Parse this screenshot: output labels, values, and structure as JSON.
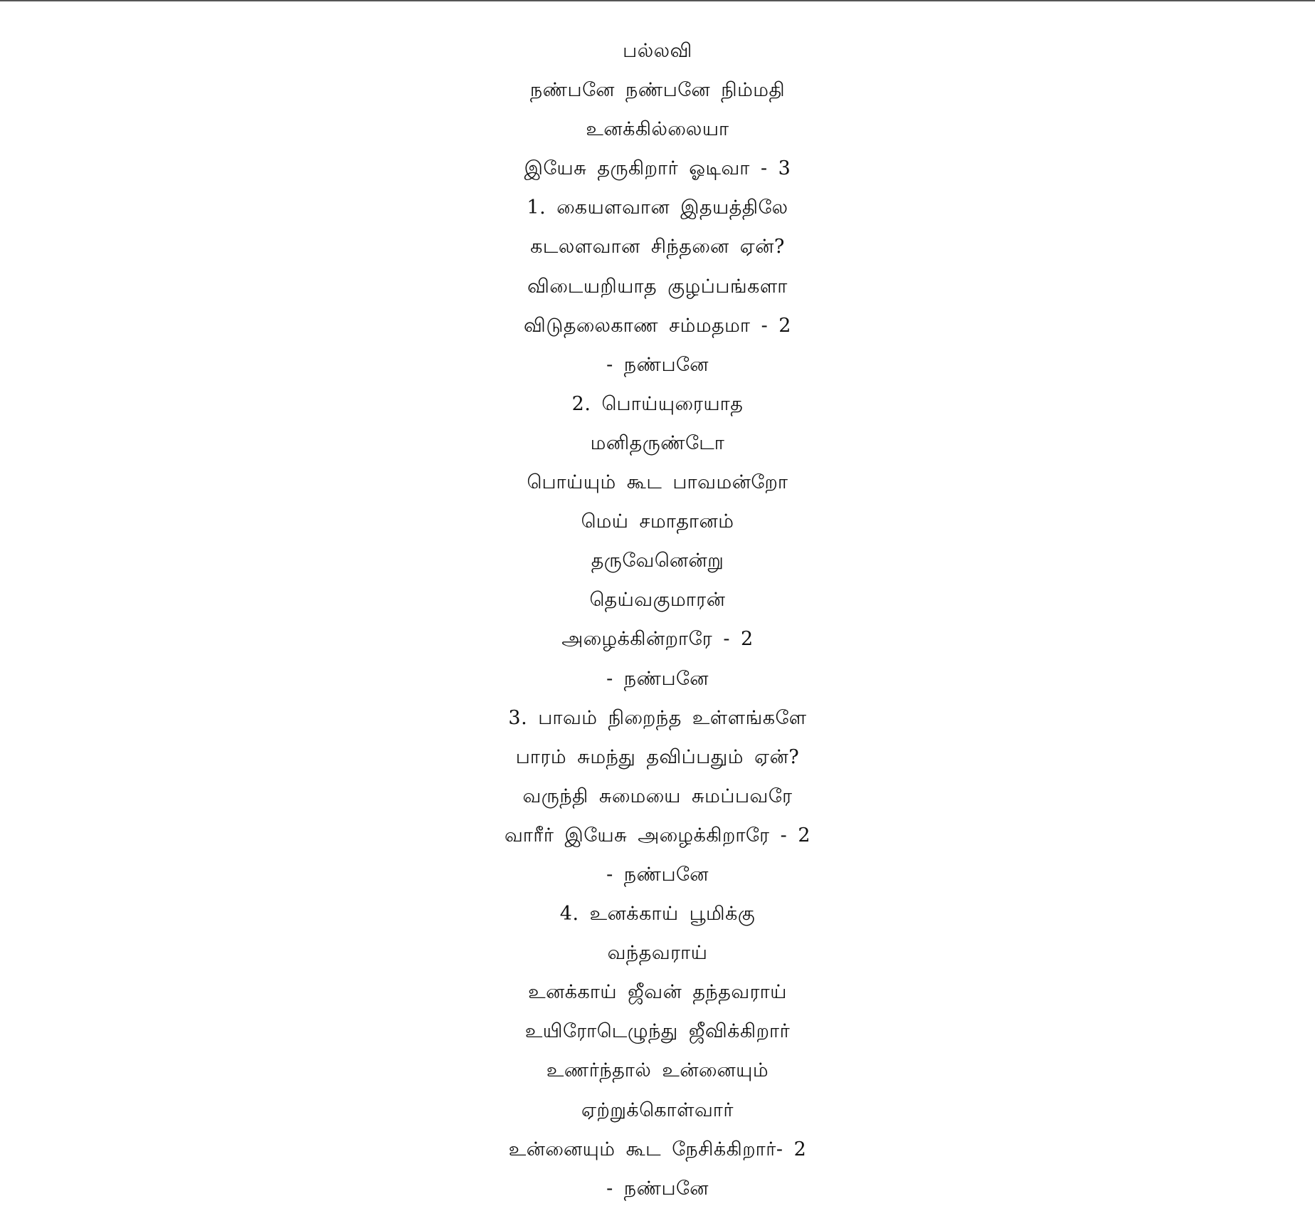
{
  "lines": [
    "பல்லவி",
    "நண்பனே நண்பனே நிம்மதி",
    "உனக்கில்லையா",
    "இயேசு தருகிறார் ஓடிவா - 3",
    "1. கையளவான இதயத்திலே",
    "கடலளவான சிந்தனை ஏன்?",
    "விடையறியாத குழப்பங்களா",
    "விடுதலைகாண சம்மதமா - 2",
    "- நண்பனே",
    "2. பொய்யுரையாத",
    "மனிதருண்டோ",
    "பொய்யும் கூட பாவமன்றோ",
    "மெய் சமாதானம்",
    "தருவேனென்று",
    "தெய்வகுமாரன்",
    "அழைக்கின்றாரே - 2",
    "- நண்பனே",
    "3. பாவம் நிறைந்த உள்ளங்களே",
    "பாரம் சுமந்து தவிப்பதும் ஏன்?",
    "வருந்தி சுமையை சுமப்பவரே",
    "வாரீர் இயேசு அழைக்கிறாரே - 2",
    "- நண்பனே",
    "4. உனக்காய் பூமிக்கு",
    "வந்தவராய்",
    "உனக்காய் ஜீவன் தந்தவராய்",
    "உயிரோடெழுந்து ஜீவிக்கிறார்",
    "உணர்ந்தால் உன்னையும்",
    "ஏற்றுக்கொள்வார்",
    "உன்னையும் கூட நேசிக்கிறார்- 2",
    "- நண்பனே"
  ]
}
